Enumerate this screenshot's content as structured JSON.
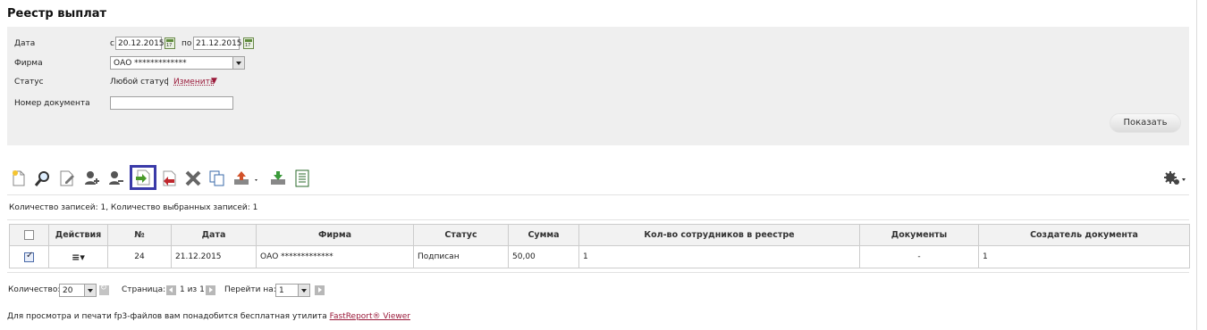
{
  "page": {
    "title": "Реестр выплат"
  },
  "filters": {
    "date_label": "Дата",
    "date_from_prefix": "с",
    "date_from": "20.12.2015",
    "date_to_prefix": "по",
    "date_to": "21.12.2015",
    "calendar_day": "17",
    "firm_label": "Фирма",
    "firm_value": "ОАО  *************",
    "status_label": "Статус",
    "status_value": "Любой статус",
    "status_separator": "|",
    "status_change": "Изменить",
    "status_change_icon": "▼",
    "doc_number_label": "Номер документа",
    "doc_number_value": "",
    "show_button": "Показать"
  },
  "toolbar": {
    "icons": [
      "new-document-icon",
      "search-icon",
      "edit-document-icon",
      "add-employee-icon",
      "remove-employee-icon",
      "sign-icon",
      "unsign-icon",
      "delete-icon",
      "copy-icon",
      "export-icon",
      "import-icon",
      "report-icon"
    ],
    "selected": "sign-icon",
    "settings_icon": "gear-icon"
  },
  "summary": {
    "text": "Количество записей: 1, Количество выбранных записей: 1"
  },
  "table": {
    "headers": [
      "",
      "Действия",
      "№",
      "Дата",
      "Фирма",
      "Статус",
      "Сумма",
      "Кол-во сотрудников в реестре",
      "Документы",
      "Создатель документа"
    ],
    "rows": [
      {
        "checked": true,
        "actions_icon": "≡▾",
        "number": "24",
        "date": "21.12.2015",
        "firm": "ОАО   *************",
        "status": "Подписан",
        "sum": "50,00",
        "employees": "1",
        "documents": "-",
        "creator": "1"
      }
    ]
  },
  "pager": {
    "count_label": "Количество:",
    "count_value": "20",
    "page_label": "Страница:",
    "page_info": "1 из 1",
    "goto_label": "Перейти на:",
    "goto_value": "1"
  },
  "footer": {
    "text": "Для просмотра и печати fp3-файлов вам понадобится бесплатная утилита",
    "link": "FastReport® Viewer"
  },
  "colors": {
    "accent_red": "#9a1a3a",
    "panel_bg": "#efefef",
    "selected_border": "#3a3aa8"
  }
}
